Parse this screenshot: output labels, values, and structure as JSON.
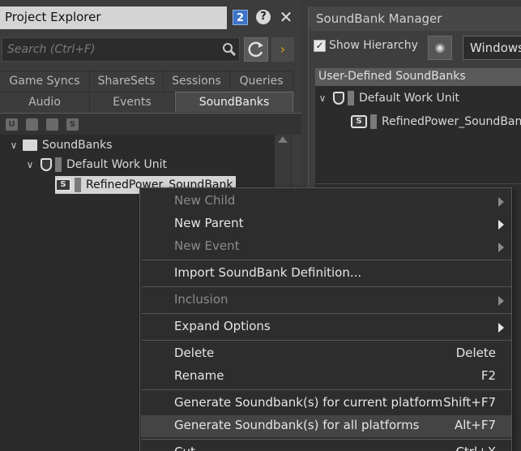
{
  "project_explorer": {
    "title": "Project Explorer",
    "badge": "2",
    "help": "?",
    "close": "✕",
    "search_placeholder": "Search (Ctrl+F)",
    "tabs_row1": [
      "Game Syncs",
      "ShareSets",
      "Sessions",
      "Queries"
    ],
    "tabs_row2": [
      "Audio",
      "Events",
      "SoundBanks"
    ],
    "active_tab": "SoundBanks",
    "tree": {
      "root": "SoundBanks",
      "work_unit": "Default Work Unit",
      "soundbank": "RefinedPower_SoundBank"
    }
  },
  "soundbank_manager": {
    "title": "SoundBank Manager",
    "show_hierarchy_label": "Show Hierarchy",
    "show_hierarchy_checked": true,
    "platform": "Windows",
    "list_header": "User-Defined SoundBanks",
    "work_unit": "Default Work Unit",
    "soundbank": "RefinedPower_SoundBank"
  },
  "context_menu": {
    "items": [
      {
        "label": "New Child",
        "disabled": true,
        "submenu": true
      },
      {
        "label": "New Parent",
        "disabled": false,
        "submenu": true
      },
      {
        "label": "New Event",
        "disabled": true,
        "submenu": true
      },
      {
        "label": "Import SoundBank Definition...",
        "disabled": false
      },
      {
        "label": "Inclusion",
        "disabled": true,
        "submenu": true
      },
      {
        "label": "Expand Options",
        "disabled": false,
        "submenu": true
      },
      {
        "label": "Delete",
        "shortcut": "Delete",
        "disabled": false
      },
      {
        "label": "Rename",
        "shortcut": "F2",
        "disabled": false
      },
      {
        "label": "Generate Soundbank(s) for current platform",
        "shortcut": "Shift+F7",
        "disabled": false
      },
      {
        "label": "Generate Soundbank(s) for all platforms",
        "shortcut": "Alt+F7",
        "disabled": false,
        "highlighted": true
      },
      {
        "label": "Cut",
        "shortcut": "Ctrl+X",
        "disabled": false
      }
    ]
  },
  "colors": {
    "accent_blue": "#3d74c8",
    "menu_bg": "#2d2d2d",
    "selection_bg": "#d4d4d4"
  }
}
